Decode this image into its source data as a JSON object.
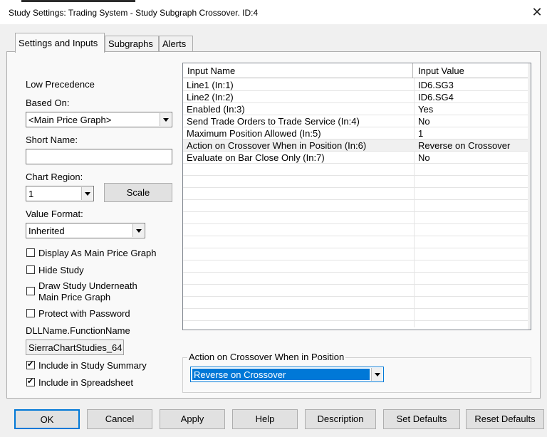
{
  "window": {
    "title": "Study Settings: Trading System - Study Subgraph Crossover. ID:4",
    "close_symbol": "✕"
  },
  "tabs": [
    {
      "label": "Settings and Inputs",
      "active": true
    },
    {
      "label": "Subgraphs",
      "active": false
    },
    {
      "label": "Alerts",
      "active": false
    }
  ],
  "left": {
    "precedence": "Low Precedence",
    "based_on_label": "Based On:",
    "based_on_value": "<Main Price Graph>",
    "short_name_label": "Short Name:",
    "short_name_value": "",
    "chart_region_label": "Chart Region:",
    "chart_region_value": "1",
    "scale_button": "Scale",
    "value_format_label": "Value Format:",
    "value_format_value": "Inherited",
    "checkboxes": [
      {
        "label": "Display As Main Price Graph",
        "checked": false
      },
      {
        "label": "Hide Study",
        "checked": false
      },
      {
        "label_line1": "Draw Study Underneath",
        "label_line2": "Main Price Graph",
        "checked": false
      },
      {
        "label": "Protect with Password",
        "checked": false
      }
    ],
    "dll_label": "DLLName.FunctionName",
    "dll_value": "SierraChartStudies_64",
    "summary_checkboxes": [
      {
        "label": "Include in Study Summary",
        "checked": true
      },
      {
        "label": "Include in Spreadsheet",
        "checked": true
      }
    ]
  },
  "inputs_table": {
    "columns": [
      "Input Name",
      "Input Value"
    ],
    "rows": [
      {
        "name": "Line1   (In:1)",
        "value": "ID6.SG3"
      },
      {
        "name": "Line2   (In:2)",
        "value": "ID6.SG4"
      },
      {
        "name": "Enabled   (In:3)",
        "value": "Yes"
      },
      {
        "name": "Send Trade Orders to Trade Service   (In:4)",
        "value": "No"
      },
      {
        "name": "Maximum Position Allowed   (In:5)",
        "value": "1"
      },
      {
        "name": "Action on Crossover When in Position   (In:6)",
        "value": "Reverse on Crossover"
      },
      {
        "name": "Evaluate on Bar Close Only   (In:7)",
        "value": "No"
      }
    ],
    "selected_row": 5
  },
  "editor": {
    "group_title": "Action on Crossover When in Position",
    "value": "Reverse on Crossover"
  },
  "buttons": {
    "ok": "OK",
    "cancel": "Cancel",
    "apply": "Apply",
    "help": "Help",
    "description": "Description",
    "set_defaults": "Set Defaults",
    "reset_defaults": "Reset Defaults"
  }
}
